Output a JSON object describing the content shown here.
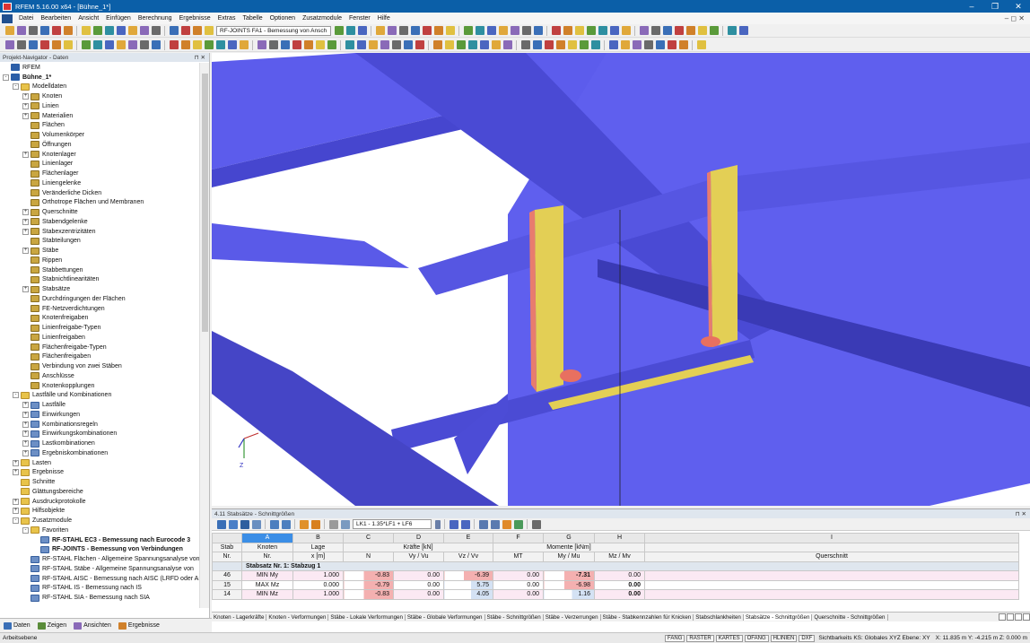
{
  "window": {
    "title": "RFEM 5.16.00 x64 - [Bühne_1*]",
    "minimize": "–",
    "restore": "❐",
    "close": "✕"
  },
  "menu": {
    "items": [
      "Datei",
      "Bearbeiten",
      "Ansicht",
      "Einfügen",
      "Berechnung",
      "Ergebnisse",
      "Extras",
      "Tabelle",
      "Optionen",
      "Zusatzmodule",
      "Fenster",
      "Hilfe"
    ],
    "right": "– ◻ ✕"
  },
  "toolbar": {
    "module_combo": "RF-JOINTS FA1 - Bemessung von Ansch"
  },
  "navigator": {
    "title": "Projekt-Navigator - Daten",
    "pin": "⊓ ✕",
    "items": [
      {
        "label": "RFEM",
        "level": 0,
        "exp": "",
        "icon": "root"
      },
      {
        "label": "Bühne_1*",
        "level": 0,
        "exp": "-",
        "icon": "root",
        "bold": true
      },
      {
        "label": "Modelldaten",
        "level": 1,
        "exp": "-",
        "icon": "folder"
      },
      {
        "label": "Knoten",
        "level": 2,
        "exp": "+",
        "icon": "item"
      },
      {
        "label": "Linien",
        "level": 2,
        "exp": "+",
        "icon": "item"
      },
      {
        "label": "Materialien",
        "level": 2,
        "exp": "+",
        "icon": "item"
      },
      {
        "label": "Flächen",
        "level": 2,
        "exp": "",
        "icon": "item"
      },
      {
        "label": "Volumenkörper",
        "level": 2,
        "exp": "",
        "icon": "item"
      },
      {
        "label": "Öffnungen",
        "level": 2,
        "exp": "",
        "icon": "item"
      },
      {
        "label": "Knotenlager",
        "level": 2,
        "exp": "+",
        "icon": "item"
      },
      {
        "label": "Linienlager",
        "level": 2,
        "exp": "",
        "icon": "item"
      },
      {
        "label": "Flächenlager",
        "level": 2,
        "exp": "",
        "icon": "item"
      },
      {
        "label": "Liniengelenke",
        "level": 2,
        "exp": "",
        "icon": "item"
      },
      {
        "label": "Veränderliche Dicken",
        "level": 2,
        "exp": "",
        "icon": "item"
      },
      {
        "label": "Orthotrope Flächen und Membranen",
        "level": 2,
        "exp": "",
        "icon": "item"
      },
      {
        "label": "Querschnitte",
        "level": 2,
        "exp": "+",
        "icon": "item"
      },
      {
        "label": "Stabendgelenke",
        "level": 2,
        "exp": "+",
        "icon": "item"
      },
      {
        "label": "Stabexzentrizitäten",
        "level": 2,
        "exp": "+",
        "icon": "item"
      },
      {
        "label": "Stabteilungen",
        "level": 2,
        "exp": "",
        "icon": "item"
      },
      {
        "label": "Stäbe",
        "level": 2,
        "exp": "+",
        "icon": "item"
      },
      {
        "label": "Rippen",
        "level": 2,
        "exp": "",
        "icon": "item"
      },
      {
        "label": "Stabbettungen",
        "level": 2,
        "exp": "",
        "icon": "item"
      },
      {
        "label": "Stabnichtlinearitäten",
        "level": 2,
        "exp": "",
        "icon": "item"
      },
      {
        "label": "Stabsätze",
        "level": 2,
        "exp": "+",
        "icon": "item"
      },
      {
        "label": "Durchdringungen der Flächen",
        "level": 2,
        "exp": "",
        "icon": "item"
      },
      {
        "label": "FE-Netzverdichtungen",
        "level": 2,
        "exp": "",
        "icon": "item"
      },
      {
        "label": "Knotenfreigaben",
        "level": 2,
        "exp": "",
        "icon": "item"
      },
      {
        "label": "Linienfreigabe-Typen",
        "level": 2,
        "exp": "",
        "icon": "item"
      },
      {
        "label": "Linienfreigaben",
        "level": 2,
        "exp": "",
        "icon": "item"
      },
      {
        "label": "Flächenfreigabe-Typen",
        "level": 2,
        "exp": "",
        "icon": "item"
      },
      {
        "label": "Flächenfreigaben",
        "level": 2,
        "exp": "",
        "icon": "item"
      },
      {
        "label": "Verbindung von zwei Stäben",
        "level": 2,
        "exp": "",
        "icon": "item"
      },
      {
        "label": "Anschlüsse",
        "level": 2,
        "exp": "",
        "icon": "item"
      },
      {
        "label": "Knotenkopplungen",
        "level": 2,
        "exp": "",
        "icon": "item"
      },
      {
        "label": "Lastfälle und Kombinationen",
        "level": 1,
        "exp": "-",
        "icon": "folder"
      },
      {
        "label": "Lastfälle",
        "level": 2,
        "exp": "+",
        "icon": "doc"
      },
      {
        "label": "Einwirkungen",
        "level": 2,
        "exp": "+",
        "icon": "doc"
      },
      {
        "label": "Kombinationsregeln",
        "level": 2,
        "exp": "+",
        "icon": "doc"
      },
      {
        "label": "Einwirkungskombinationen",
        "level": 2,
        "exp": "+",
        "icon": "doc"
      },
      {
        "label": "Lastkombinationen",
        "level": 2,
        "exp": "+",
        "icon": "doc"
      },
      {
        "label": "Ergebniskombinationen",
        "level": 2,
        "exp": "+",
        "icon": "doc"
      },
      {
        "label": "Lasten",
        "level": 1,
        "exp": "+",
        "icon": "folder"
      },
      {
        "label": "Ergebnisse",
        "level": 1,
        "exp": "+",
        "icon": "folder"
      },
      {
        "label": "Schnitte",
        "level": 1,
        "exp": "",
        "icon": "folder"
      },
      {
        "label": "Glättungsbereiche",
        "level": 1,
        "exp": "",
        "icon": "folder"
      },
      {
        "label": "Ausdruckprotokolle",
        "level": 1,
        "exp": "+",
        "icon": "folder"
      },
      {
        "label": "Hilfsobjekte",
        "level": 1,
        "exp": "+",
        "icon": "folder"
      },
      {
        "label": "Zusatzmodule",
        "level": 1,
        "exp": "-",
        "icon": "folder"
      },
      {
        "label": "Favoriten",
        "level": 2,
        "exp": "-",
        "icon": "folder"
      },
      {
        "label": "RF-STAHL EC3 - Bemessung nach Eurocode 3",
        "level": 3,
        "exp": "",
        "icon": "doc",
        "bold": true
      },
      {
        "label": "RF-JOINTS - Bemessung von Verbindungen",
        "level": 3,
        "exp": "",
        "icon": "doc",
        "bold": true
      },
      {
        "label": "RF-STAHL Flächen - Allgemeine Spannungsanalyse von",
        "level": 2,
        "exp": "",
        "icon": "doc"
      },
      {
        "label": "RF-STAHL Stäbe - Allgemeine Spannungsanalyse von",
        "level": 2,
        "exp": "",
        "icon": "doc"
      },
      {
        "label": "RF-STAHL AISC - Bemessung nach AISC (LRFD oder A:",
        "level": 2,
        "exp": "",
        "icon": "doc"
      },
      {
        "label": "RF-STAHL IS - Bemessung nach IS",
        "level": 2,
        "exp": "",
        "icon": "doc"
      },
      {
        "label": "RF-STAHL SIA - Bemessung nach SIA",
        "level": 2,
        "exp": "",
        "icon": "doc"
      }
    ],
    "tabs": [
      "Daten",
      "Zeigen",
      "Ansichten",
      "Ergebnisse"
    ]
  },
  "viewport": {
    "axis_label": "Z",
    "colors": {
      "beam": "#5c5cec",
      "beam_dark": "#3b3bb8",
      "plate": "#e3cf55",
      "bolt": "#e87060"
    }
  },
  "results": {
    "title": "4.11 Stabsätze - Schnittgrößen",
    "pin": "⊓ ✕",
    "loadcase": "LK1 - 1.35*LF1 + LF6",
    "col_letters": [
      "A",
      "B",
      "C",
      "D",
      "E",
      "F",
      "G",
      "H",
      "I"
    ],
    "h_stab": "Stab",
    "h_nr": "Nr.",
    "h_knoten": "Knoten",
    "h_knoten2": "Nr.",
    "h_lage": "Lage",
    "h_lage2": "x [m]",
    "h_kraefte": "Kräfte [kN]",
    "h_momente": "Momente [kNm]",
    "h_N": "N",
    "h_Vy": "Vy / Vu",
    "h_Vz": "Vz / Vv",
    "h_MT": "MT",
    "h_My": "My / Mu",
    "h_Mz": "Mz / Mv",
    "h_qs": "Querschnitt",
    "group": "Stabsatz Nr. 1: Stabzug 1",
    "rows": [
      {
        "stab": "46",
        "knoten": "MIN My",
        "x": "1.000",
        "N": "-0.83",
        "Vy": "0.00",
        "Vz": "-6.39",
        "MT": "0.00",
        "My": "-7.31",
        "Mz": "0.00"
      },
      {
        "stab": "15",
        "knoten": "MAX Mz",
        "x": "0.000",
        "N": "-0.79",
        "Vy": "0.00",
        "Vz": "5.75",
        "MT": "0.00",
        "My": "-6.98",
        "Mz": "0.00"
      },
      {
        "stab": "14",
        "knoten": "MIN Mz",
        "x": "1.000",
        "N": "-0.83",
        "Vy": "0.00",
        "Vz": "4.05",
        "MT": "0.00",
        "My": "1.16",
        "Mz": "0.00"
      }
    ],
    "tabs": [
      "Knoten - Lagerkräfte",
      "Knoten - Verformungen",
      "Stäbe - Lokale Verformungen",
      "Stäbe - Globale Verformungen",
      "Stäbe - Schnittgrößen",
      "Stäbe - Verzerrungen",
      "Stäbe - Stabkennzahlen für Knicken",
      "Stabschlankheiten",
      "Stabsätze - Schnittgrößen",
      "Querschnitte - Schnittgrößen"
    ],
    "active_tab": "Stabsätze - Schnittgrößen"
  },
  "status": {
    "left": "Arbeitsebene",
    "toggles": [
      "FANG",
      "RASTER",
      "KARTES",
      "OFANG",
      "HLINIEN",
      "DXF"
    ],
    "info": "Sichtbarkeits KS: Globales XYZ Ebene: XY",
    "coords": "X: 11.835 m   Y: -4.215 m   Z: 0.000 m"
  }
}
